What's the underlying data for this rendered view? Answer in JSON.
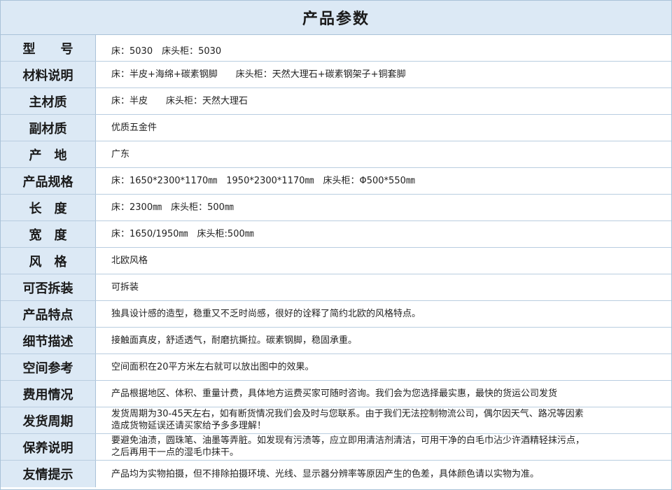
{
  "title": "产品参数",
  "rows": [
    {
      "label": "型　　号",
      "value": "床：5030　床头柜：5030"
    },
    {
      "label": "材料说明",
      "value": "床：半皮+海绵+碳素钢脚　　床头柜：天然大理石+碳素钢架子+铜套脚"
    },
    {
      "label": "主材质",
      "value": "床：半皮　　床头柜：天然大理石"
    },
    {
      "label": "副材质",
      "value": "优质五金件"
    },
    {
      "label": "产　地",
      "value": "广东"
    },
    {
      "label": "产品规格",
      "value": "床：1650*2300*1170㎜　1950*2300*1170㎜　床头柜：Φ500*550㎜"
    },
    {
      "label": "长　度",
      "value": "床：2300㎜　床头柜：500㎜"
    },
    {
      "label": "宽　度",
      "value": "床：1650/1950㎜　床头柜:500㎜"
    },
    {
      "label": "风　格",
      "value": "北欧风格"
    },
    {
      "label": "可否拆装",
      "value": "可拆装"
    },
    {
      "label": "产品特点",
      "value": "独具设计感的造型，稳重又不乏时尚感，很好的诠释了简约北欧的风格特点。"
    },
    {
      "label": "细节描述",
      "value": "接触面真皮，舒适透气，耐磨抗撕拉。碳素钢脚，稳固承重。"
    },
    {
      "label": "空间参考",
      "value": "空间面积在20平方米左右就可以放出图中的效果。"
    },
    {
      "label": "费用情况",
      "value": "产品根据地区、体积、重量计费，具体地方运费买家可随时咨询。我们会为您选择最实惠，最快的货运公司发货"
    },
    {
      "label": "发货周期",
      "value": "发货周期为30-45天左右，如有断货情况我们会及时与您联系。由于我们无法控制物流公司，偶尔因天气、路况等因素\n造成货物延误还请买家给予多多理解！"
    },
    {
      "label": "保养说明",
      "value": "要避免油渍，圆珠笔、油墨等弄脏。如发现有污渍等，应立即用清洁剂清洁，可用干净的白毛巾沾少许酒精轻抹污点，\n之后再用干一点的湿毛巾抹干。"
    },
    {
      "label": "友情提示",
      "value": "产品均为实物拍摄，但不排除拍摄环境、光线、显示器分辨率等原因产生的色差，具体颜色请以实物为准。"
    }
  ]
}
